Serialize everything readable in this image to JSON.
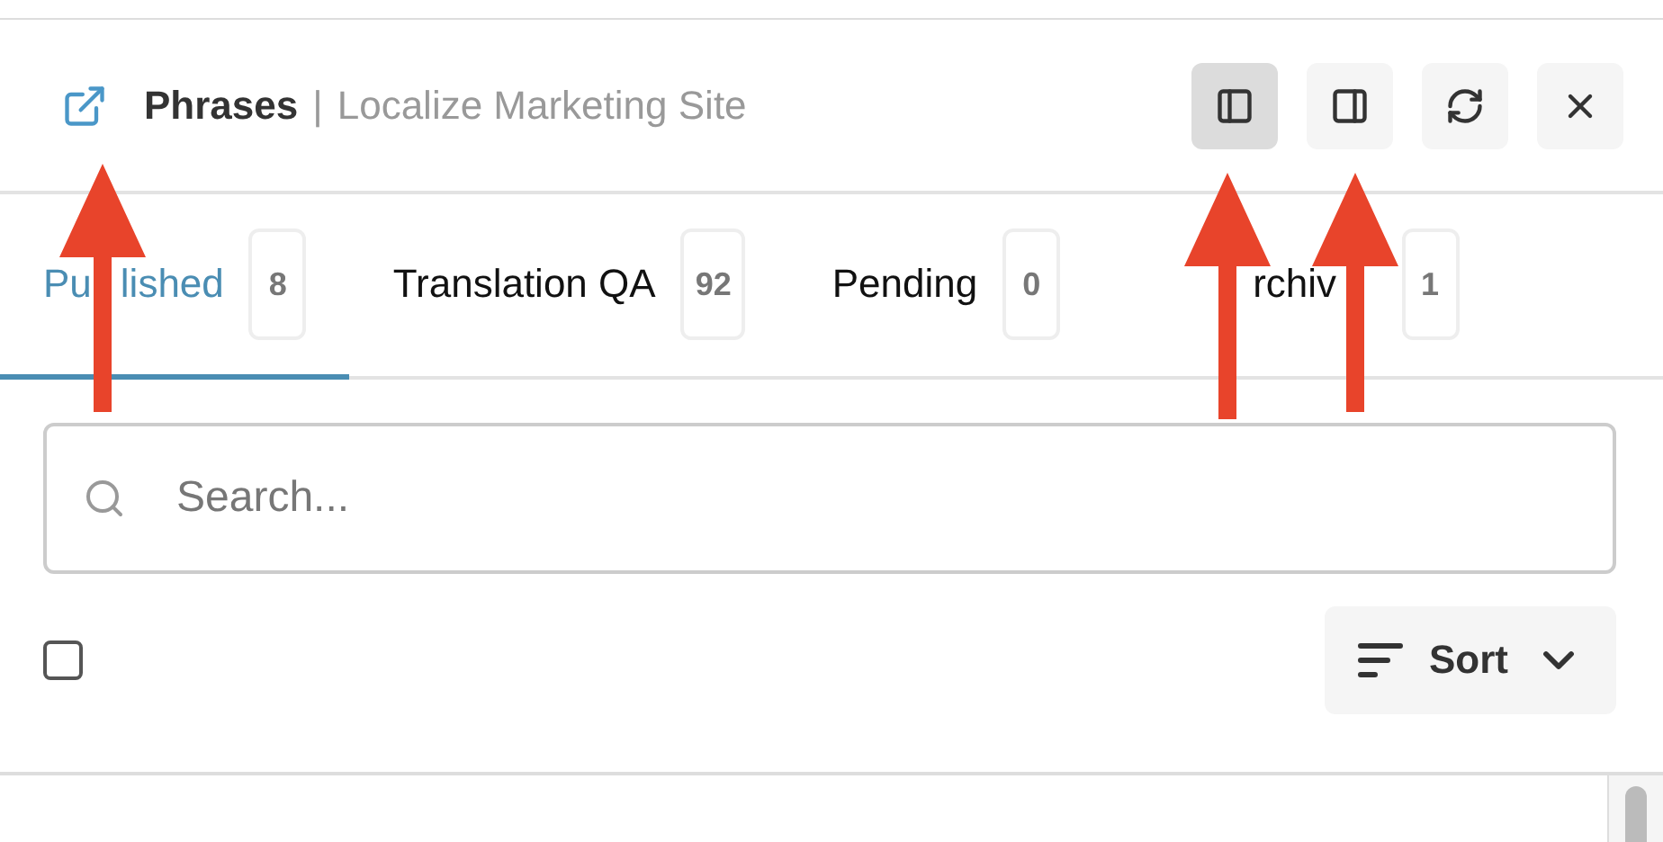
{
  "header": {
    "title": "Phrases",
    "separator": "|",
    "subtitle": "Localize Marketing Site",
    "buttons": [
      {
        "kind": "sidebar-left",
        "selected": true
      },
      {
        "kind": "sidebar-right",
        "selected": false
      },
      {
        "kind": "refresh",
        "selected": false
      },
      {
        "kind": "close",
        "selected": false
      }
    ]
  },
  "tabs": [
    {
      "label_parts": [
        "Pu",
        "lished"
      ],
      "count": "8",
      "selected": true
    },
    {
      "label": "Translation QA",
      "count": "92",
      "selected": false
    },
    {
      "label": "Pending",
      "count": "0",
      "selected": false
    },
    {
      "label_parts": [
        "rchiv"
      ],
      "count": "1",
      "selected": false
    }
  ],
  "search": {
    "placeholder": "Search..."
  },
  "select_all": {
    "checked": false
  },
  "sort": {
    "label": "Sort"
  },
  "annotations": [
    {
      "kind": "arrow"
    },
    {
      "kind": "arrow"
    },
    {
      "kind": "arrow"
    }
  ]
}
